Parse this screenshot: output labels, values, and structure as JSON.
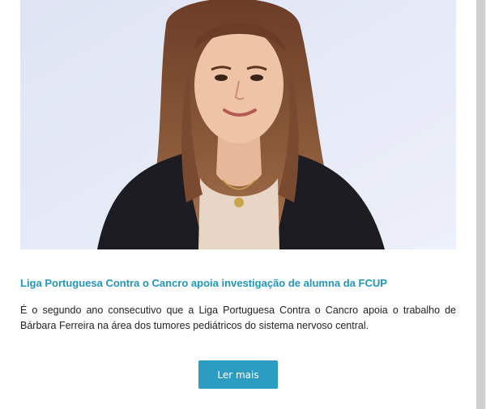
{
  "article": {
    "image_alt": "Portrait photo of a smiling young woman with long brown hair",
    "title": "Liga Portuguesa Contra o Cancro apoia investigação de alumna da FCUP",
    "summary": "É o segundo ano consecutivo que a Liga Portuguesa Contra o Cancro apoia o trabalho de Bárbara Ferreira na área dos tumores pediátricos do sistema nervoso central.",
    "read_more_label": "Ler mais"
  },
  "colors": {
    "accent": "#2a9dc0",
    "title": "#2196bb",
    "photo_background": "#e6eaf7"
  }
}
